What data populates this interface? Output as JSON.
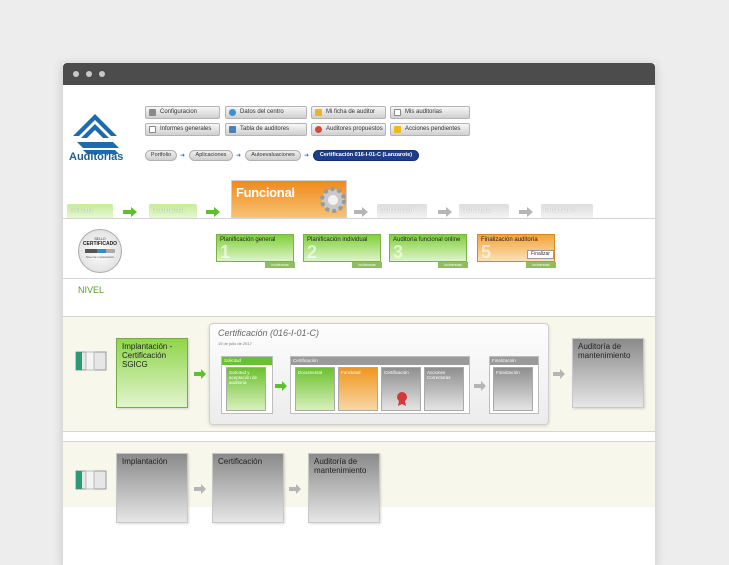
{
  "app": {
    "name": "Auditorias"
  },
  "toolbar": {
    "buttons": [
      {
        "label": "Configuracion",
        "icon": "wrench-icon"
      },
      {
        "label": "Datos del centro",
        "icon": "globe-icon"
      },
      {
        "label": "Mi ficha de auditor",
        "icon": "user-card-icon"
      },
      {
        "label": "Mis auditorias",
        "icon": "document-icon"
      },
      {
        "label": "Informes generales",
        "icon": "report-icon"
      },
      {
        "label": "Tabla de auditores",
        "icon": "table-icon"
      },
      {
        "label": "Auditores propuestos",
        "icon": "people-icon"
      },
      {
        "label": "Acciones pendientes",
        "icon": "warning-icon"
      }
    ]
  },
  "breadcrumb": [
    "Portfolio",
    "Aplicaciones",
    "Autoevaluaciones",
    "Certificación 016-I-01-C (Lanzarote)"
  ],
  "stages": {
    "solicitud": "Solicitud",
    "documental": "Documental",
    "funcional": "Funcional",
    "certificacion": "Certificación",
    "correctora": "Correctora",
    "finalizacion": "Finalización"
  },
  "badge": {
    "line1": "SELLO",
    "line2": "CERTIFICADO",
    "line3": "Nivel de implantación"
  },
  "substeps": [
    {
      "label": "Planificación general",
      "num": "1"
    },
    {
      "label": "Planificación individual",
      "num": "2"
    },
    {
      "label": "Auditoría funcional online",
      "num": "3"
    },
    {
      "label": "Finalización auditoría",
      "num": "5",
      "button": "Finalizar"
    }
  ],
  "substep_tag": "Incidencias",
  "nivel": "NIVEL",
  "row1": {
    "first_box": "Implantación - Certificación SGICG",
    "card": {
      "title": "Certificación (016-I-01-C)",
      "date": "19 de julio de 2017",
      "solicitud_header": "Solicitud",
      "solicitud_item": "Solicitud y aceptación de auditoría",
      "certificacion_header": "Certificación",
      "cert_items": [
        "Documental",
        "Funcional",
        "Certificación",
        "Acciones Correctoras"
      ],
      "finalizacion_header": "Finalización",
      "finalizacion_item": "Finalización"
    },
    "last_box": "Auditoría de mantenimiento"
  },
  "row2": {
    "boxes": [
      "Implantación",
      "Certificación",
      "Auditoría de mantenimiento"
    ]
  },
  "colors": {
    "green": "#7fd03c",
    "orange": "#f08a1a",
    "navy": "#1d3f8a"
  }
}
